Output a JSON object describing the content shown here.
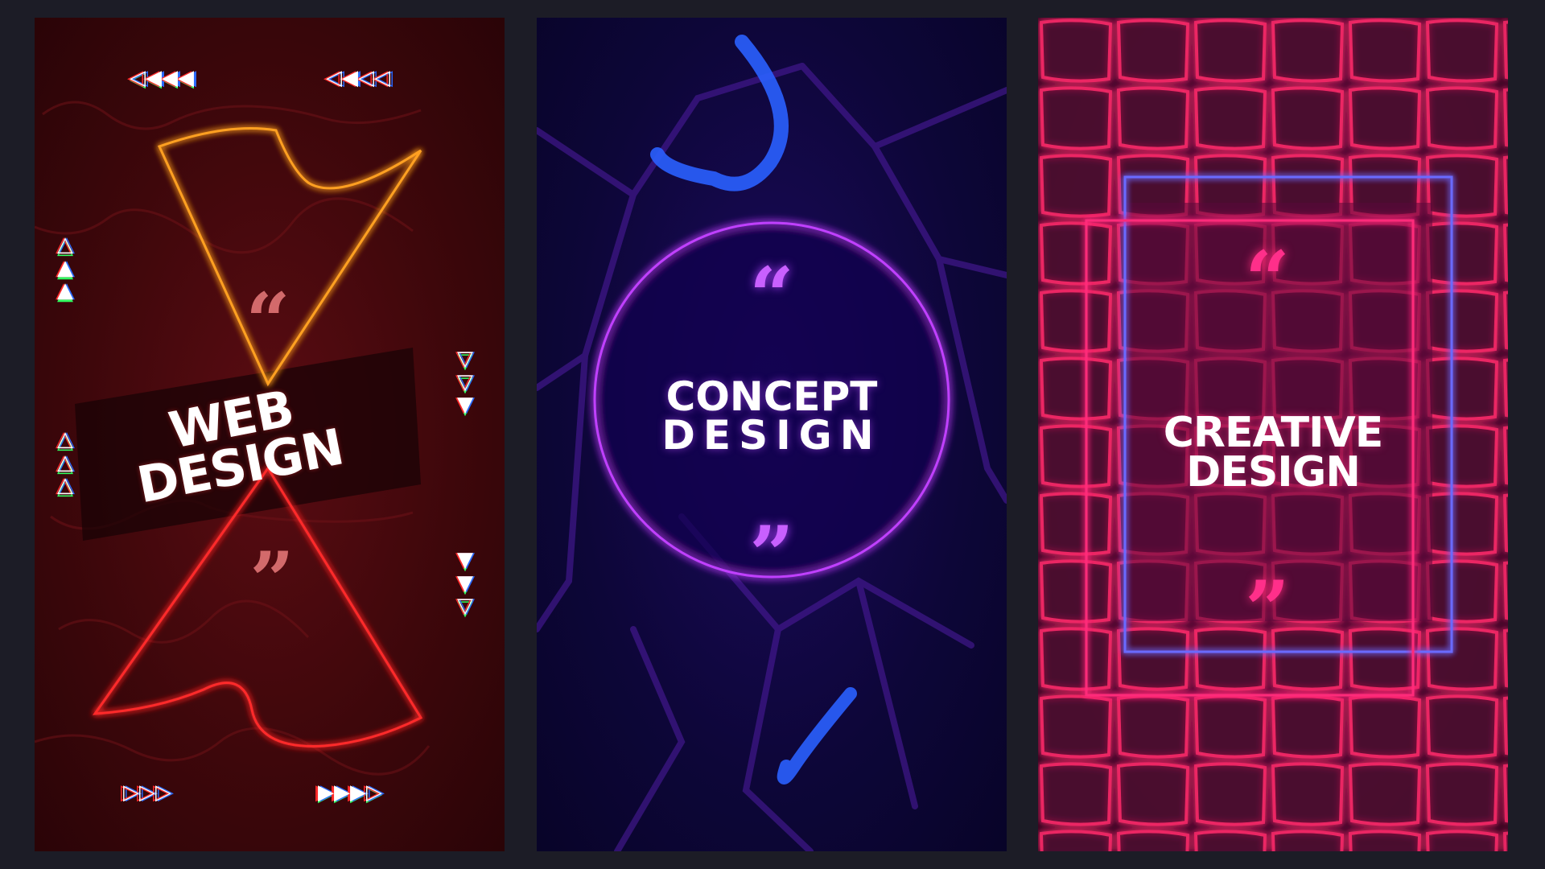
{
  "panels": [
    {
      "title_line1": "WEB",
      "title_line2": "DESIGN",
      "open_quote": "“",
      "close_quote": "”",
      "accent_top": "#ffb020",
      "accent_bottom": "#ff3030"
    },
    {
      "title_line1": "CONCEPT",
      "title_line2": "DESIGN",
      "open_quote": "“",
      "close_quote": "”",
      "accent": "#c040ff"
    },
    {
      "title_line1": "CREATIVE",
      "title_line2": "DESIGN",
      "open_quote": "“",
      "close_quote": "”",
      "accent_pink": "#ff2a7a",
      "accent_blue": "#6b6bff"
    }
  ],
  "icons": [
    "rewind-arrows-icon",
    "triangle-up-icon",
    "triangle-down-icon",
    "forward-arrows-icon"
  ]
}
